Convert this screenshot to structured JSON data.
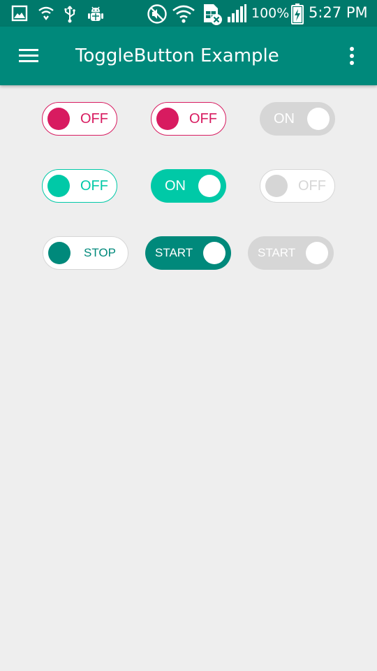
{
  "status_bar": {
    "battery_level": "100%",
    "time": "5:27 PM",
    "icons": [
      "image-icon",
      "vpn-shield-icon",
      "usb-icon",
      "android-debug-icon",
      "mute-icon",
      "wifi-icon",
      "sim-error-icon",
      "signal-icon",
      "battery-charging-icon"
    ]
  },
  "app_bar": {
    "title": "ToggleButton Example",
    "menu_icon": "menu-icon",
    "overflow_icon": "more-vert-icon"
  },
  "colors": {
    "status_bar": "#00796b",
    "app_bar": "#00897b",
    "pink_accent": "#d81b60",
    "teal_light": "#00c9a7",
    "teal_dark": "#00897b",
    "disabled": "#d6d6d6",
    "background": "#eeeeee"
  },
  "toggles": {
    "row1": [
      {
        "label": "OFF",
        "checked": false,
        "enabled": true
      },
      {
        "label": "OFF",
        "checked": false,
        "enabled": true
      },
      {
        "label": "ON",
        "checked": true,
        "enabled": false
      }
    ],
    "row2": [
      {
        "label": "OFF",
        "checked": false,
        "enabled": true
      },
      {
        "label": "ON",
        "checked": true,
        "enabled": true
      },
      {
        "label": "OFF",
        "checked": false,
        "enabled": false
      }
    ],
    "row3": [
      {
        "label": "STOP",
        "checked": false,
        "enabled": true
      },
      {
        "label": "START",
        "checked": true,
        "enabled": true
      },
      {
        "label": "START",
        "checked": true,
        "enabled": false
      }
    ]
  }
}
